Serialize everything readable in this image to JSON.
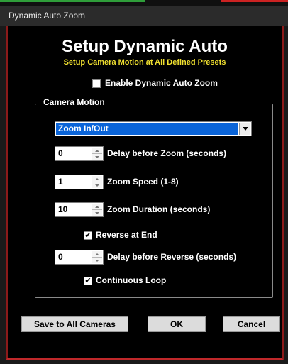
{
  "window": {
    "title": "Dynamic Auto Zoom"
  },
  "header": {
    "title": "Setup Dynamic Auto",
    "subtitle": "Setup Camera Motion at All Defined Presets"
  },
  "enable_zoom": {
    "label": "Enable Dynamic Auto Zoom",
    "checked": false
  },
  "camera_motion": {
    "legend": "Camera Motion",
    "mode": {
      "value": "Zoom In/Out"
    },
    "delay_before_zoom": {
      "value": "0",
      "label": "Delay before Zoom (seconds)"
    },
    "zoom_speed": {
      "value": "1",
      "label": "Zoom Speed (1-8)"
    },
    "zoom_duration": {
      "value": "10",
      "label": "Zoom Duration (seconds)"
    },
    "reverse_at_end": {
      "label": "Reverse at End",
      "checked": true
    },
    "delay_before_reverse": {
      "value": "0",
      "label": "Delay before Reverse (seconds)"
    },
    "continuous_loop": {
      "label": "Continuous Loop",
      "checked": true
    }
  },
  "buttons": {
    "save_all": "Save to All Cameras",
    "ok": "OK",
    "cancel": "Cancel"
  },
  "colors": {
    "subtitle": "#f0e030",
    "selection": "#0a64d8",
    "frame_red": "#c0282a"
  }
}
